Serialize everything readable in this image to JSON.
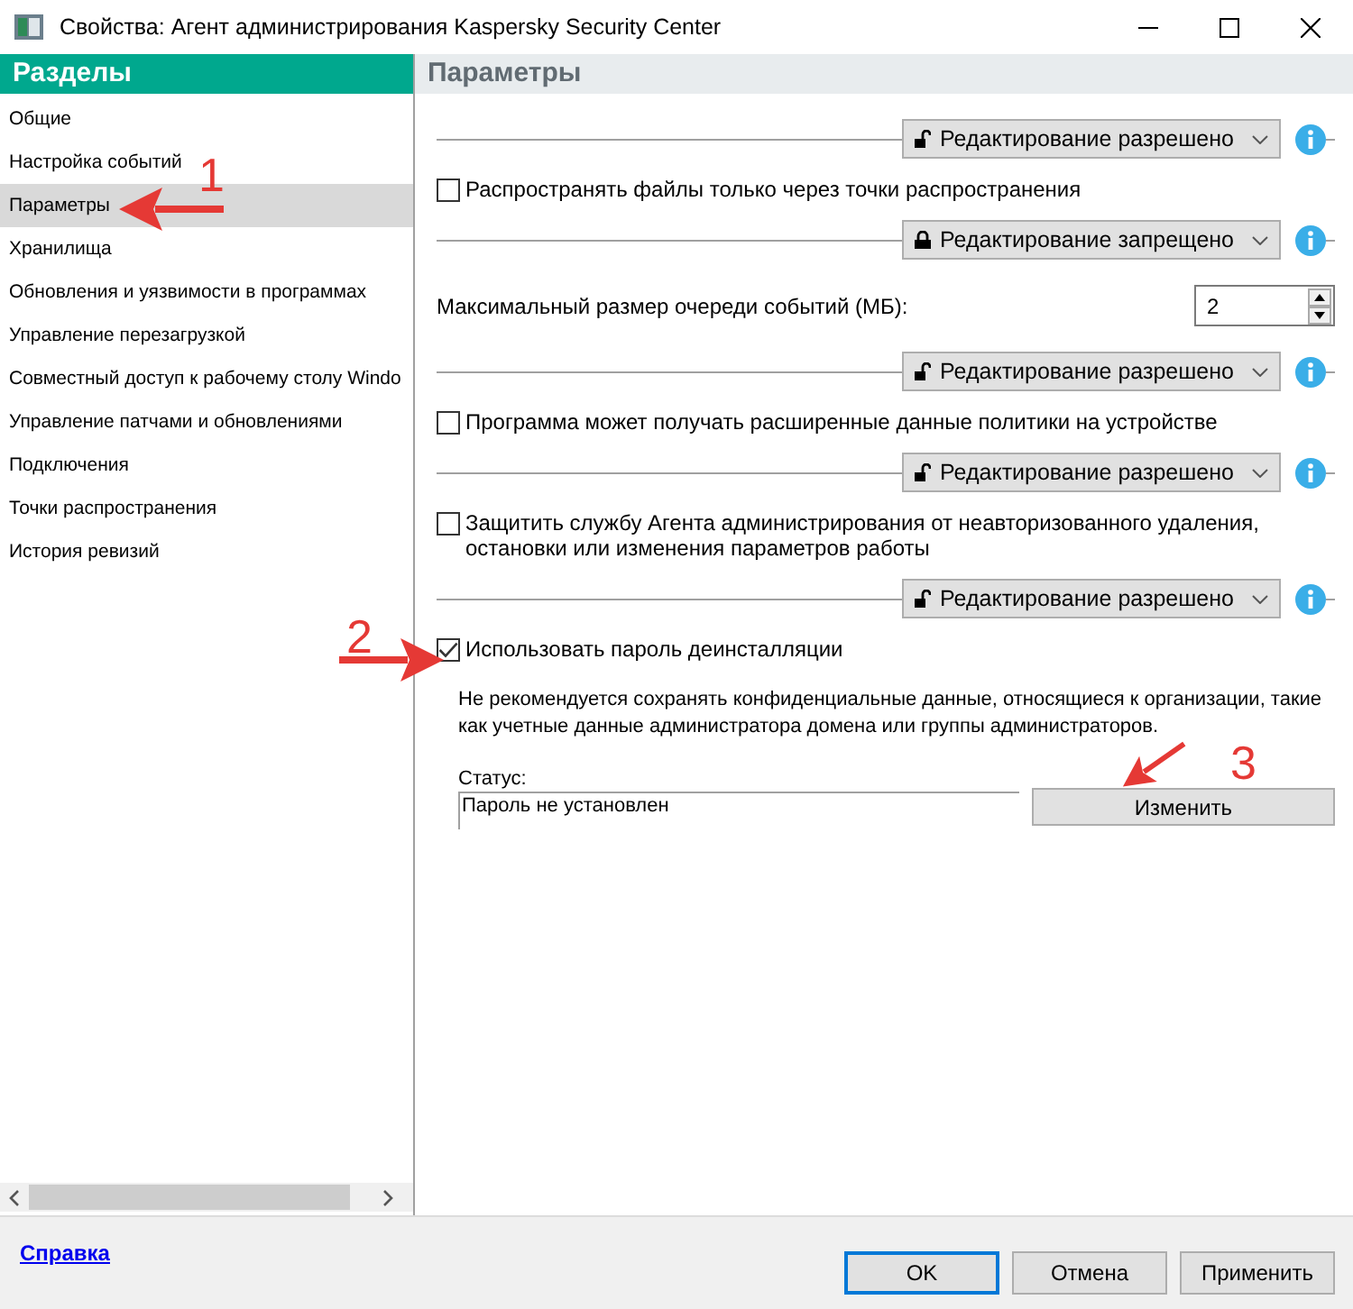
{
  "window": {
    "title": "Свойства: Агент администрирования Kaspersky Security Center"
  },
  "sidebar": {
    "title": "Разделы",
    "items": [
      {
        "label": "Общие",
        "selected": false
      },
      {
        "label": "Настройка событий",
        "selected": false
      },
      {
        "label": "Параметры",
        "selected": true
      },
      {
        "label": "Хранилища",
        "selected": false
      },
      {
        "label": "Обновления и уязвимости в программах",
        "selected": false
      },
      {
        "label": "Управление перезагрузкой",
        "selected": false
      },
      {
        "label": "Совместный доступ к рабочему столу Windo",
        "selected": false
      },
      {
        "label": "Управление патчами и обновлениями",
        "selected": false
      },
      {
        "label": "Подключения",
        "selected": false
      },
      {
        "label": "Точки распространения",
        "selected": false
      },
      {
        "label": "История ревизий",
        "selected": false
      }
    ]
  },
  "panel": {
    "title": "Параметры",
    "rows": [
      {
        "kind": "policy",
        "label": "Редактирование разрешено",
        "locked": false
      },
      {
        "kind": "checkbox",
        "label": "Распространять файлы только через точки распространения",
        "checked": false
      },
      {
        "kind": "policy",
        "label": "Редактирование запрещено",
        "locked": true
      },
      {
        "kind": "number",
        "label": "Максимальный размер очереди событий (МБ):",
        "value": "2"
      },
      {
        "kind": "policy",
        "label": "Редактирование разрешено",
        "locked": false
      },
      {
        "kind": "checkbox",
        "label": "Программа может получать расширенные данные политики на устройстве",
        "checked": false
      },
      {
        "kind": "policy",
        "label": "Редактирование разрешено",
        "locked": false
      },
      {
        "kind": "checkbox",
        "label": "Защитить службу Агента администрирования от неавторизованного удаления, остановки или изменения параметров работы",
        "checked": false
      },
      {
        "kind": "policy",
        "label": "Редактирование разрешено",
        "locked": false
      },
      {
        "kind": "checkbox",
        "label": "Использовать пароль деинсталляции",
        "checked": true
      }
    ],
    "note": "Не рекомендуется сохранять конфиденциальные данные, относящиеся к организации, такие как учетные данные администратора домена или группы администраторов.",
    "status_label": "Статус:",
    "status_value": "Пароль не установлен",
    "change_button": "Изменить"
  },
  "footer": {
    "help_link": "Справка",
    "buttons": [
      {
        "label": "OK",
        "default": true
      },
      {
        "label": "Отмена",
        "default": false
      },
      {
        "label": "Применить",
        "default": false
      }
    ]
  },
  "annotations": [
    {
      "label": "1"
    },
    {
      "label": "2"
    },
    {
      "label": "3"
    }
  ]
}
